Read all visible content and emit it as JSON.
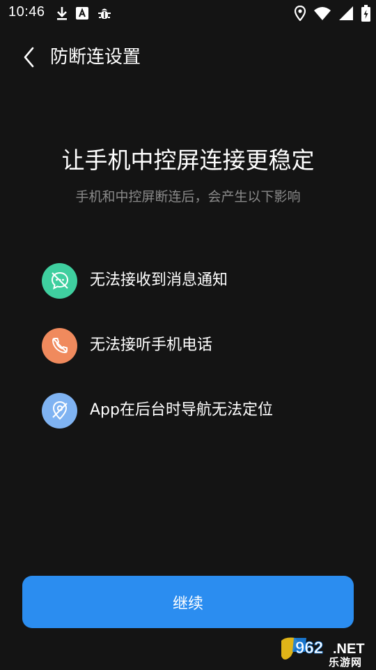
{
  "status_bar": {
    "time": "10:46",
    "left_icons": [
      "download-icon",
      "font-a-icon",
      "bug-icon"
    ],
    "right_icons": [
      "location-icon",
      "wifi-icon",
      "signal-icon",
      "battery-charging-icon"
    ]
  },
  "header": {
    "title": "防断连设置",
    "back_icon": "chevron-left-icon"
  },
  "main": {
    "headline": "让手机中控屏连接更稳定",
    "subheadline": "手机和中控屏断连后，会产生以下影响",
    "impacts": [
      {
        "label": "无法接收到消息通知",
        "icon": "message-off-icon",
        "color": "#3fcf9f"
      },
      {
        "label": "无法接听手机电话",
        "icon": "phone-off-icon",
        "color": "#f08a5d"
      },
      {
        "label": "App在后台时导航无法定位",
        "icon": "location-off-icon",
        "color": "#7fb3f2"
      }
    ]
  },
  "footer": {
    "continue_label": "继续"
  },
  "watermark": {
    "logo_text": "962.NET",
    "sub_text": "乐游网"
  },
  "colors": {
    "background": "#141414",
    "primary": "#2b8df0",
    "subtext": "#8a8a8a"
  }
}
